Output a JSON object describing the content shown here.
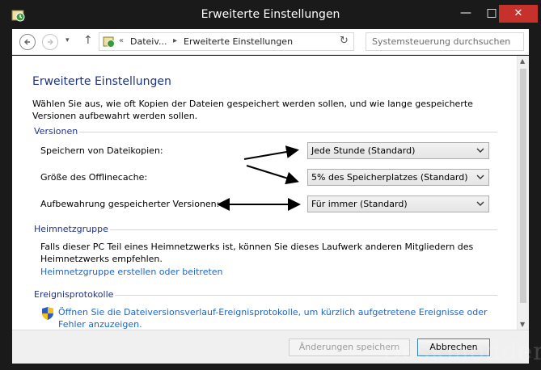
{
  "window": {
    "title": "Erweiterte Einstellungen",
    "minimize": "—",
    "maximize": "□",
    "close": "✕"
  },
  "nav": {
    "back": "←",
    "forward": "→",
    "recent": "▾",
    "up": "↑",
    "breadcrumb_prefix": "«",
    "breadcrumb": [
      "Dateiv...",
      "Erweiterte Einstellungen"
    ],
    "breadcrumb_sep": "▸",
    "refresh": "↻",
    "search_placeholder": "Systemsteuerung durchsuchen"
  },
  "page": {
    "title": "Erweiterte Einstellungen",
    "description": "Wählen Sie aus, wie oft Kopien der Dateien gespeichert werden sollen, und wie lange gespeicherte Versionen aufbewahrt werden sollen."
  },
  "versions": {
    "heading": "Versionen",
    "save_copies_label": "Speichern von Dateikopien:",
    "save_copies_value": "Jede Stunde (Standard)",
    "cache_size_label": "Größe des Offlinecache:",
    "cache_size_value": "5% des Speicherplatzes (Standard)",
    "retention_label": "Aufbewahrung gespeicherter Versionen:",
    "retention_value": "Für immer (Standard)"
  },
  "homegroup": {
    "heading": "Heimnetzgruppe",
    "text": "Falls dieser PC Teil eines Heimnetzwerks ist, können Sie dieses Laufwerk anderen Mitgliedern des Heimnetzwerks empfehlen.",
    "link": "Heimnetzgruppe erstellen oder beitreten"
  },
  "events": {
    "heading": "Ereignisprotokolle",
    "link": "Öffnen Sie die Dateiversionsverlauf-Ereignisprotokolle, um kürzlich aufgetretene Ereignisse oder Fehler anzuzeigen."
  },
  "footer": {
    "save_label": "Änderungen speichern",
    "cancel_label": "Abbrechen"
  },
  "watermark": "Deskmodder.de",
  "colors": {
    "heading_blue": "#1e3287",
    "link_blue": "#1c66c8",
    "close_red": "#c7312b",
    "frame": "#1a1a1a"
  }
}
